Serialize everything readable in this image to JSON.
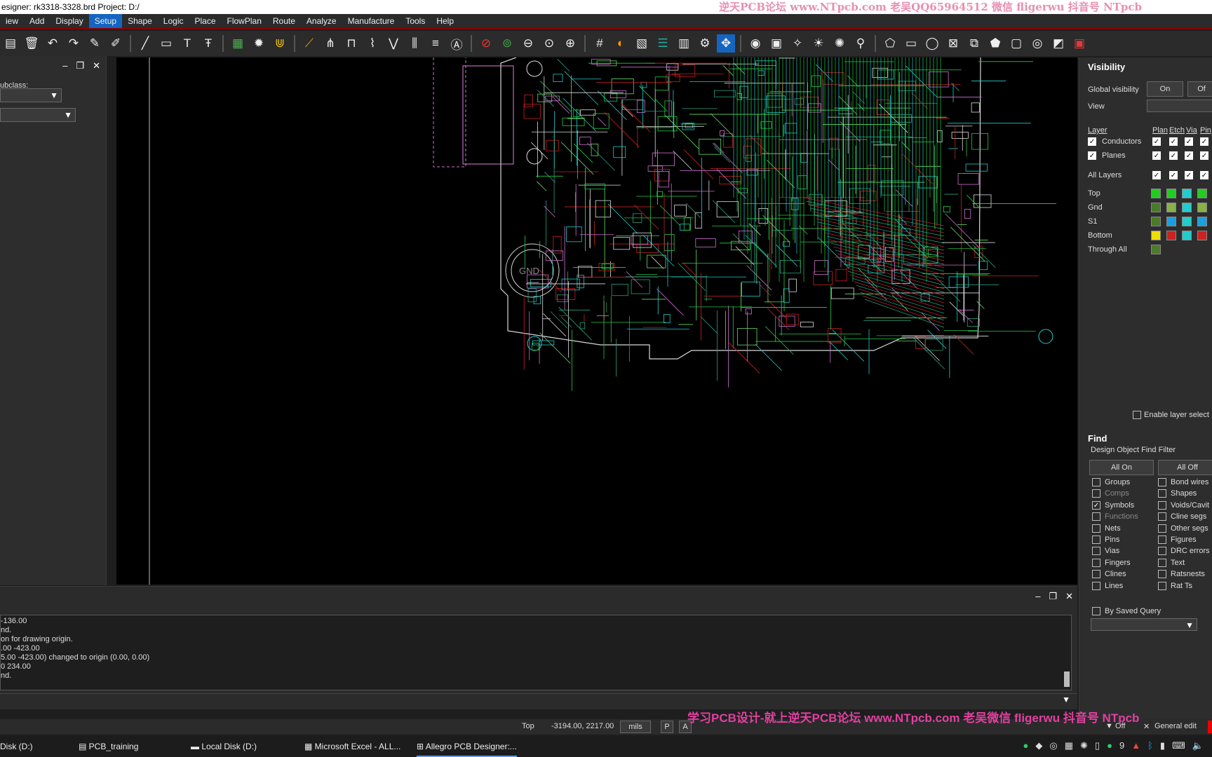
{
  "titlebar": {
    "title": "esigner: rk3318-3328.brd  Project: D:/",
    "watermark": "逆天PCB论坛 www.NTpcb.com 老吴QQ65964512  微信 fligerwu 抖音号 NTpcb"
  },
  "menu": [
    {
      "label": "iew",
      "active": false
    },
    {
      "label": "Add",
      "active": false
    },
    {
      "label": "Display",
      "active": false
    },
    {
      "label": "Setup",
      "active": true
    },
    {
      "label": "Shape",
      "active": false
    },
    {
      "label": "Logic",
      "active": false
    },
    {
      "label": "Place",
      "active": false
    },
    {
      "label": "FlowPlan",
      "active": false
    },
    {
      "label": "Route",
      "active": false
    },
    {
      "label": "Analyze",
      "active": false
    },
    {
      "label": "Manufacture",
      "active": false
    },
    {
      "label": "Tools",
      "active": false
    },
    {
      "label": "Help",
      "active": false
    }
  ],
  "left_panel": {
    "subclass_label": "ubclass:"
  },
  "visibility": {
    "title": "Visibility",
    "global_label": "Global visibility",
    "on_label": "On",
    "off_label": "Of",
    "view_label": "View",
    "header": {
      "layer": "Layer",
      "plan": "Plan",
      "etch": "Etch",
      "via": "Via",
      "pin": "Pin"
    },
    "rows_check": [
      {
        "name": "Conductors"
      },
      {
        "name": "Planes"
      }
    ],
    "all_layers": "All Layers",
    "layers": [
      {
        "name": "Top",
        "colors": [
          "#22cc22",
          "#22cc22",
          "#22cccc",
          "#22cc22"
        ]
      },
      {
        "name": "Gnd",
        "colors": [
          "#4a7a2a",
          "#8ab04a",
          "#22cccc",
          "#8ab04a"
        ]
      },
      {
        "name": "S1",
        "colors": [
          "#4a7a2a",
          "#1aa0e0",
          "#22cccc",
          "#1aa0e0"
        ]
      },
      {
        "name": "Bottom",
        "colors": [
          "#eedd00",
          "#cc2222",
          "#22cccc",
          "#cc2222"
        ]
      },
      {
        "name": "Through All",
        "colors": [
          "#4a7a2a"
        ]
      }
    ],
    "enable_layer_select": "Enable layer select"
  },
  "find": {
    "title": "Find",
    "filter_label": "Design Object Find Filter",
    "all_on": "All On",
    "all_off": "All Off",
    "left_items": [
      {
        "label": "Groups",
        "checked": false,
        "disabled": false
      },
      {
        "label": "Comps",
        "checked": false,
        "disabled": true
      },
      {
        "label": "Symbols",
        "checked": true,
        "disabled": false
      },
      {
        "label": "Functions",
        "checked": false,
        "disabled": true
      },
      {
        "label": "Nets",
        "checked": false,
        "disabled": false
      },
      {
        "label": "Pins",
        "checked": false,
        "disabled": false
      },
      {
        "label": "Vias",
        "checked": false,
        "disabled": false
      },
      {
        "label": "Fingers",
        "checked": false,
        "disabled": false
      },
      {
        "label": "Clines",
        "checked": false,
        "disabled": false
      },
      {
        "label": "Lines",
        "checked": false,
        "disabled": false
      }
    ],
    "right_items": [
      {
        "label": "Bond wires"
      },
      {
        "label": "Shapes"
      },
      {
        "label": "Voids/Cavit"
      },
      {
        "label": "Cline segs"
      },
      {
        "label": "Other segs"
      },
      {
        "label": "Figures"
      },
      {
        "label": "DRC errors"
      },
      {
        "label": "Text"
      },
      {
        "label": "Ratsnests"
      },
      {
        "label": "Rat Ts"
      }
    ],
    "by_saved_query": "By Saved Query"
  },
  "console": {
    "lines": [
      "-136.00",
      "nd.",
      "",
      "on for drawing origin.",
      ".00 -423.00",
      "5.00 -423.00) changed to origin (0.00, 0.00)",
      "0 234.00",
      "nd."
    ]
  },
  "status": {
    "layer": "Top",
    "coords": "-3194.00, 2217.00",
    "units": "mils",
    "p": "P",
    "a": "A",
    "filter": "Off",
    "mode": "General edit",
    "watermark": "学习PCB设计-就上逆天PCB论坛 www.NTpcb.com 老吴微信 fligerwu 抖音号 NTpcb"
  },
  "taskbar": {
    "items": [
      {
        "label": "Disk (D:)",
        "active": false
      },
      {
        "label": "PCB_training",
        "active": false
      },
      {
        "label": "Local Disk (D:)",
        "active": false
      },
      {
        "label": "Microsoft Excel - ALL...",
        "active": false
      },
      {
        "label": "Allegro PCB Designer:...",
        "active": true
      }
    ],
    "tray_number": "9"
  }
}
